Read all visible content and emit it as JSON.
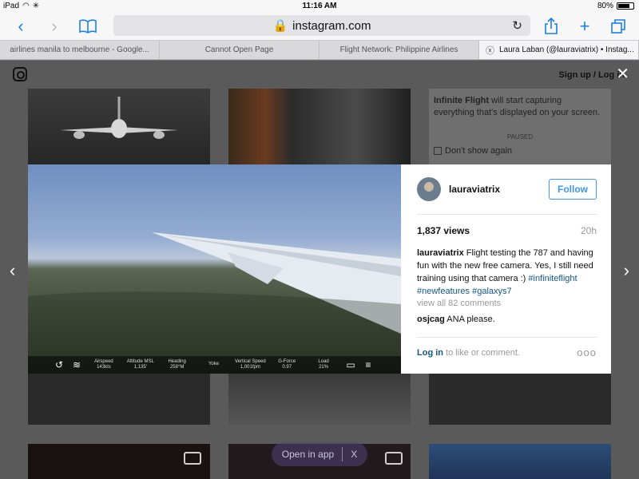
{
  "status": {
    "device": "iPad",
    "time": "11:16 AM",
    "battery": "80%",
    "battery_level": 0.8
  },
  "browser": {
    "url": "instagram.com",
    "tabs": [
      {
        "label": "airlines manila to melbourne - Google..."
      },
      {
        "label": "Cannot Open Page"
      },
      {
        "label": "Flight Network: Philippine Airlines"
      },
      {
        "label": "Laura Laban (@lauraviatrix) • Instag..."
      }
    ]
  },
  "ig": {
    "signup": "Sign up",
    "separator": "/",
    "login": "Log in"
  },
  "thumb": {
    "ff_title": "Infinite Flight",
    "ff_text": " will start capturing everything that's displayed on your screen.",
    "paused": "PAUSED",
    "dont_show": "Don't show again"
  },
  "hud": {
    "cols": [
      {
        "label": "Airspeed",
        "value": "143kts"
      },
      {
        "label": "Altitude MSL",
        "value": "1,135'"
      },
      {
        "label": "Heading",
        "value": "258°M"
      },
      {
        "label": "Yoke",
        "value": ""
      },
      {
        "label": "Vertical Speed",
        "value": "1,001fpm"
      },
      {
        "label": "G-Force",
        "value": "0.97"
      },
      {
        "label": "Load",
        "value": "21%"
      }
    ]
  },
  "post": {
    "username": "lauraviatrix",
    "follow": "Follow",
    "views": "1,837 views",
    "ago": "20h",
    "caption_user": "lauraviatrix",
    "caption_text": " Flight testing the 787 and having fun with the new free camera. Yes, I still need training using that camera :) ",
    "hashtags": [
      "#infiniteflight",
      "#newfeatures",
      "#galaxys7"
    ],
    "view_all": "view all 82 comments",
    "comment_user": "osjcag",
    "comment_text": " ANA please.",
    "login_link": "Log in",
    "login_rest": " to like or comment.",
    "more_dots": "ooo"
  },
  "open_app": {
    "label": "Open in app",
    "close": "X"
  }
}
